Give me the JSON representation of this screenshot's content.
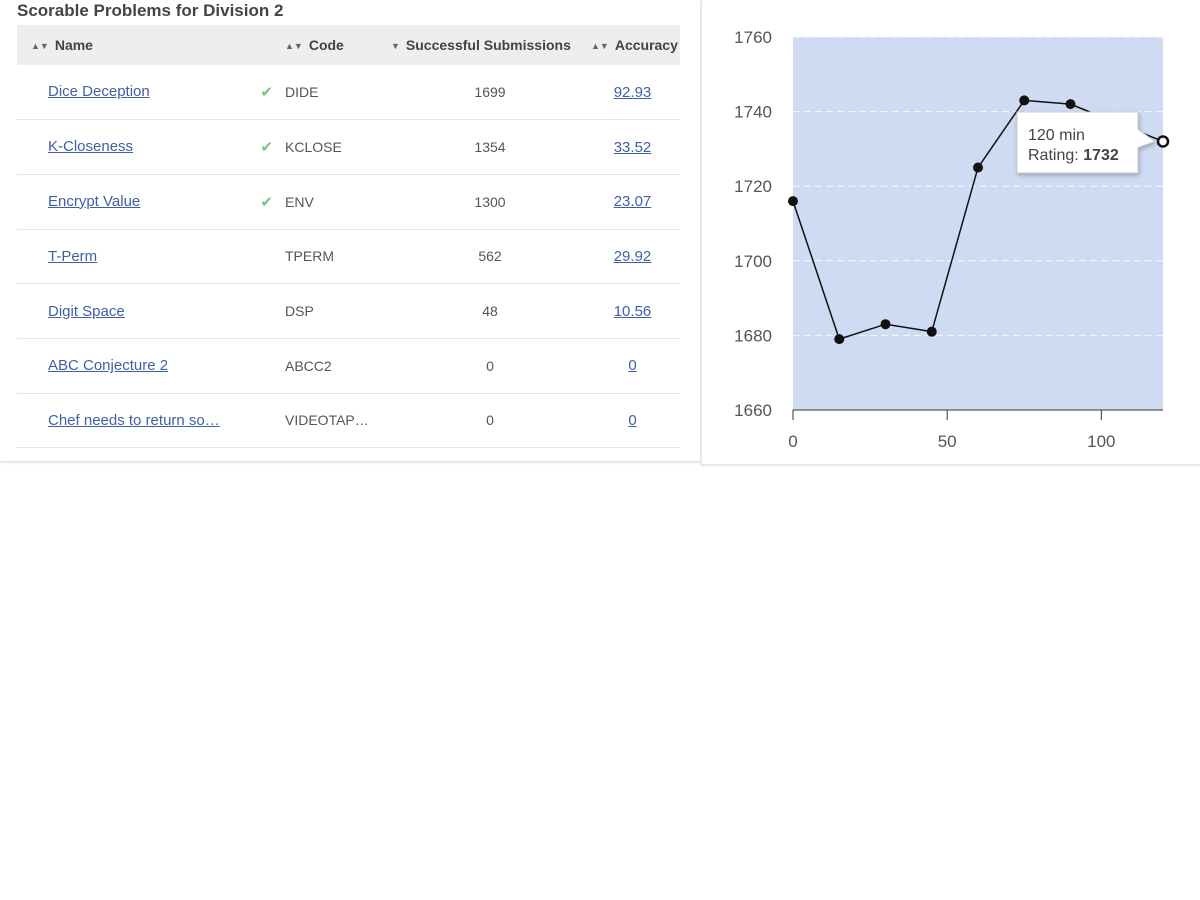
{
  "panel": {
    "title": "Scorable Problems for Division 2"
  },
  "table": {
    "headers": {
      "name": "Name",
      "code": "Code",
      "submissions": "Successful Submissions",
      "accuracy": "Accuracy"
    },
    "sort_icons": {
      "both": "▲▼",
      "down": "▼"
    },
    "check_glyph": "✔",
    "rows": [
      {
        "name": "Dice Deception",
        "solved": true,
        "code": "DIDE",
        "submissions": "1699",
        "accuracy": "92.93"
      },
      {
        "name": "K-Closeness",
        "solved": true,
        "code": "KCLOSE",
        "submissions": "1354",
        "accuracy": "33.52"
      },
      {
        "name": "Encrypt Value",
        "solved": true,
        "code": "ENV",
        "submissions": "1300",
        "accuracy": "23.07"
      },
      {
        "name": "T-Perm",
        "solved": false,
        "code": "TPERM",
        "submissions": "562",
        "accuracy": "29.92"
      },
      {
        "name": "Digit Space",
        "solved": false,
        "code": "DSP",
        "submissions": "48",
        "accuracy": "10.56"
      },
      {
        "name": "ABC Conjecture 2",
        "solved": false,
        "code": "ABCC2",
        "submissions": "0",
        "accuracy": "0"
      },
      {
        "name": "Chef needs to return so…",
        "solved": false,
        "code": "VIDEOTAP…",
        "submissions": "0",
        "accuracy": "0"
      }
    ]
  },
  "colors": {
    "plot_bg": "#cfdbf3",
    "link": "#3f5fa6",
    "check": "#7bc47f"
  },
  "chart_data": {
    "type": "line",
    "x": [
      0,
      15,
      30,
      45,
      60,
      75,
      90,
      120
    ],
    "y": [
      1716,
      1679,
      1683,
      1681,
      1725,
      1743,
      1742,
      1732
    ],
    "xlim": [
      0,
      120
    ],
    "ylim": [
      1660,
      1760
    ],
    "xticks": [
      0,
      50,
      100
    ],
    "yticks": [
      1660,
      1680,
      1700,
      1720,
      1740,
      1760
    ],
    "grid": true,
    "highlight_index": 7,
    "tooltip": {
      "line1": "120 min",
      "label": "Rating: ",
      "value": "1732"
    }
  }
}
